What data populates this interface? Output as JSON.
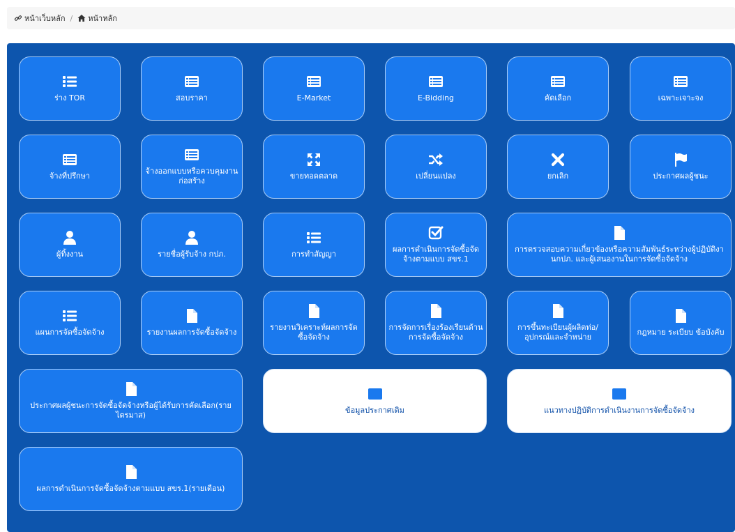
{
  "breadcrumb": {
    "first": "หน้าเว็บหลัก",
    "second": "หน้าหลัก"
  },
  "tiles": [
    {
      "label": "ร่าง TOR",
      "icon": "list-icon",
      "style": "blue"
    },
    {
      "label": "สอบราคา",
      "icon": "form-icon",
      "style": "blue"
    },
    {
      "label": "E-Market",
      "icon": "form-icon",
      "style": "blue"
    },
    {
      "label": "E-Bidding",
      "icon": "form-icon",
      "style": "blue"
    },
    {
      "label": "คัดเลือก",
      "icon": "form-icon",
      "style": "blue"
    },
    {
      "label": "เฉพาะเจาะจง",
      "icon": "form-icon",
      "style": "blue"
    },
    {
      "label": "จ้างที่ปรึกษา",
      "icon": "form-icon",
      "style": "blue"
    },
    {
      "label": "จ้างออกแบบหรือควบคุมงานก่อสร้าง",
      "icon": "form-icon",
      "style": "blue"
    },
    {
      "label": "ขายทอดตลาด",
      "icon": "expand-icon",
      "style": "blue"
    },
    {
      "label": "เปลี่ยนแปลง",
      "icon": "shuffle-icon",
      "style": "blue"
    },
    {
      "label": "ยกเลิก",
      "icon": "close-icon",
      "style": "blue"
    },
    {
      "label": "ประกาศผลผู้ชนะ",
      "icon": "flag-icon",
      "style": "blue"
    },
    {
      "label": "ผู้ทิ้งงาน",
      "icon": "user-icon",
      "style": "blue"
    },
    {
      "label": "รายชื่อผู้รับจ้าง กปภ.",
      "icon": "user-icon",
      "style": "blue"
    },
    {
      "label": "การทำสัญญา",
      "icon": "list-icon",
      "style": "blue"
    },
    {
      "label": "ผลการดำเนินการจัดซื้อจัดจ้างตามแบบ สขร.1",
      "icon": "checkbox-icon",
      "style": "blue"
    },
    {
      "label": "การตรวจสอบความเกี่ยวข้องหรือความสัมพันธ์ระหว่างผู้ปฏิบัติงานกปภ. และผู้เสนองานในการจัดซื้อจัดจ้าง",
      "icon": "file-icon",
      "style": "blue"
    },
    {
      "label": "แผนการจัดซื้อจัดจ้าง",
      "icon": "list-icon",
      "style": "blue"
    },
    {
      "label": "รายงานผลการจัดซื้อจัดจ้าง",
      "icon": "file-icon",
      "style": "blue"
    },
    {
      "label": "รายงานวิเคราะห์ผลการจัดซื้อจัดจ้าง",
      "icon": "file-icon",
      "style": "blue"
    },
    {
      "label": "การจัดการเรื่องร้องเรียนด้านการจัดซื้อจัดจ้าง",
      "icon": "file-icon",
      "style": "blue"
    },
    {
      "label": "การขึ้นทะเบียนผู้ผลิตท่อ/อุปกรณ์และจำหน่าย",
      "icon": "file-icon",
      "style": "blue"
    },
    {
      "label": "กฎหมาย ระเบียบ ข้อบังคับ",
      "icon": "file-icon",
      "style": "blue"
    },
    {
      "label": "ประกาศผลผู้ชนะการจัดซื้อจัดจ้างหรือผู้ได้รับการคัดเลือก(รายไตรมาส)",
      "icon": "file-icon",
      "style": "blue"
    },
    {
      "label": "ข้อมูลประกาศเดิม",
      "icon": "form-icon",
      "style": "white"
    },
    {
      "label": "แนวทางปฏิบัติการดำเนินงานการจัดซื้อจัดจ้าง",
      "icon": "form-icon",
      "style": "white"
    },
    {
      "label": "ผลการดำเนินการจัดซื้อจัดจ้างตามแบบ สขร.1(รายเดือน)",
      "icon": "file-icon",
      "style": "blue"
    }
  ]
}
